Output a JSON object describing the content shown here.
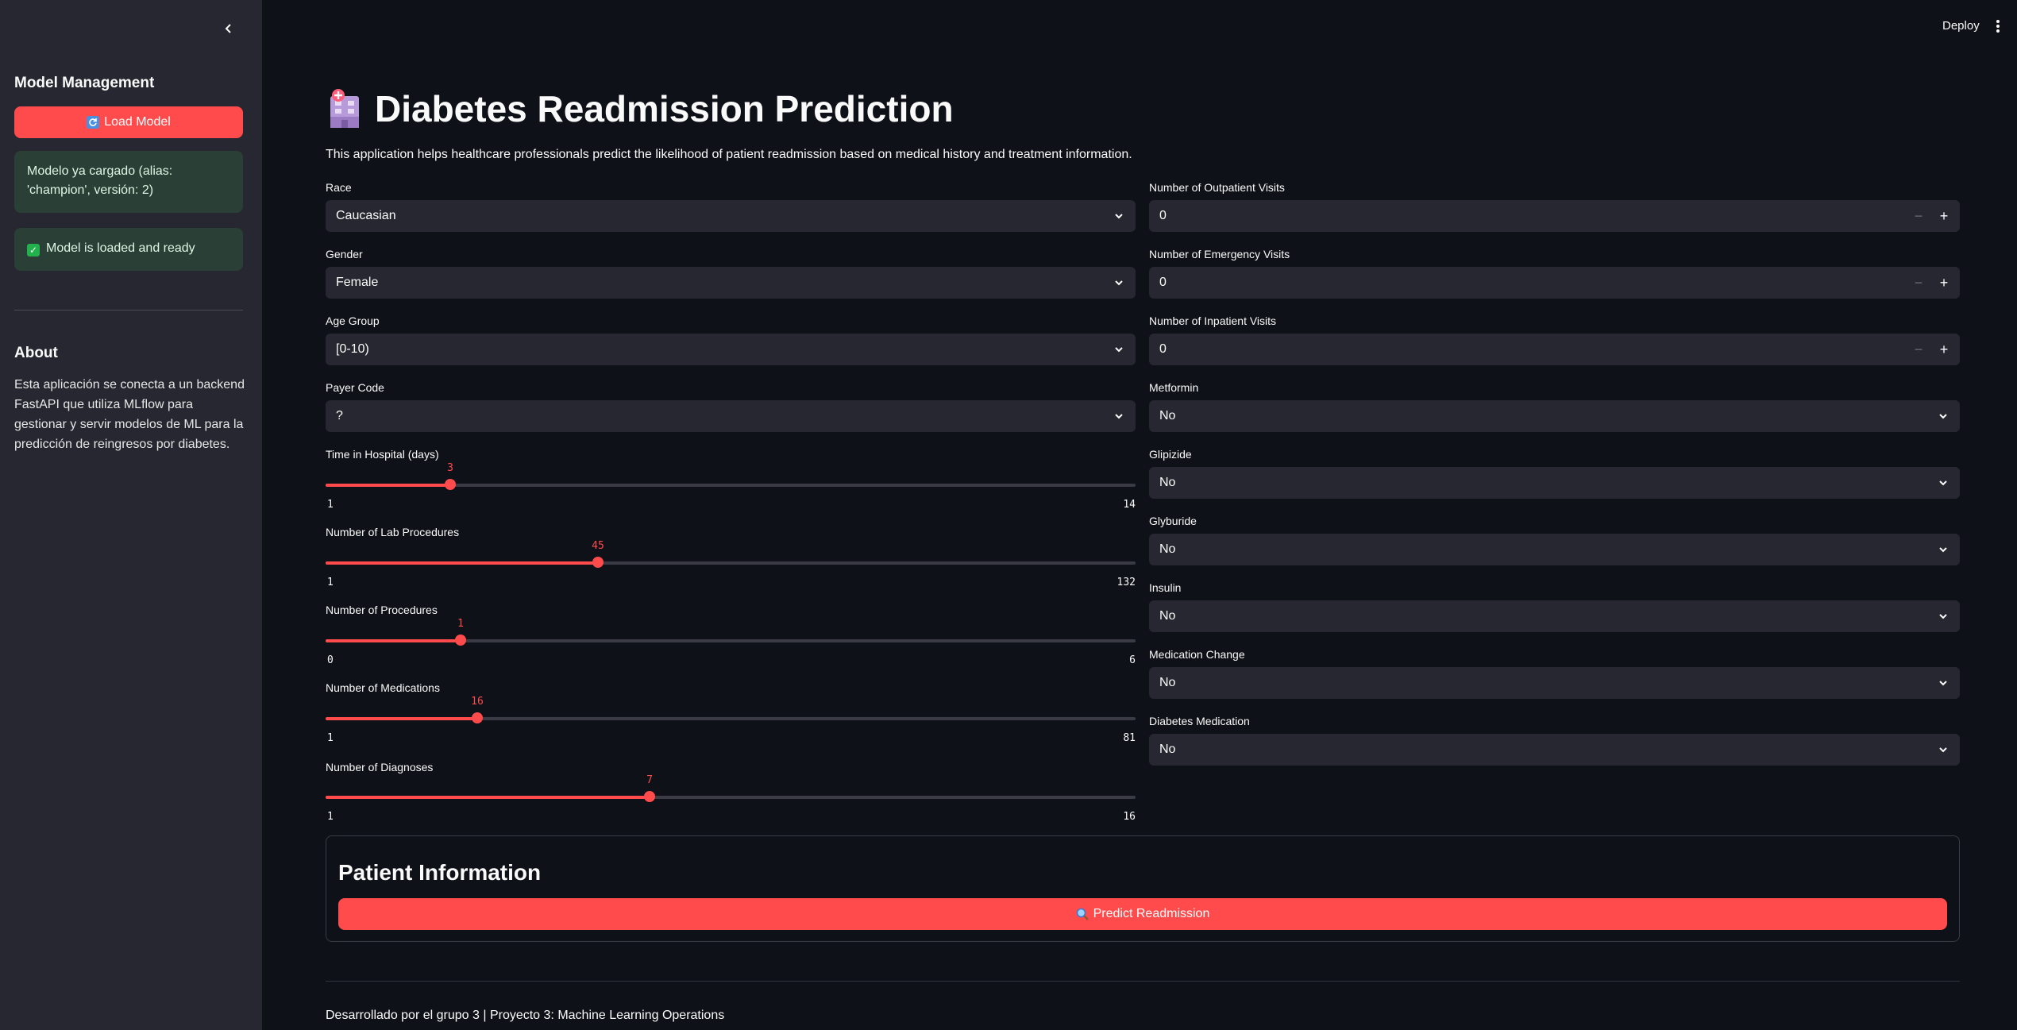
{
  "sidebar": {
    "heading": "Model Management",
    "load_button": "Load Model",
    "load_icon": "refresh-icon",
    "alert_info": "Modelo ya cargado (alias: 'champion', versión: 2)",
    "alert_success": "Model is loaded and ready",
    "about_heading": "About",
    "about_text": "Esta aplicación se conecta a un backend FastAPI que utiliza MLflow para gestionar y servir modelos de ML para la predicción de reingresos por diabetes."
  },
  "header": {
    "deploy": "Deploy"
  },
  "main": {
    "title": "Diabetes Readmission Prediction",
    "subtitle": "This application helps healthcare professionals predict the likelihood of patient readmission based on medical history and treatment information.",
    "left_selects": [
      {
        "label": "Race",
        "value": "Caucasian"
      },
      {
        "label": "Gender",
        "value": "Female"
      },
      {
        "label": "Age Group",
        "value": "[0-10)"
      },
      {
        "label": "Payer Code",
        "value": "?"
      }
    ],
    "sliders": [
      {
        "label": "Time in Hospital (days)",
        "value": 3,
        "min": 1,
        "max": 14
      },
      {
        "label": "Number of Lab Procedures",
        "value": 45,
        "min": 1,
        "max": 132
      },
      {
        "label": "Number of Procedures",
        "value": 1,
        "min": 0,
        "max": 6
      },
      {
        "label": "Number of Medications",
        "value": 16,
        "min": 1,
        "max": 81
      },
      {
        "label": "Number of Diagnoses",
        "value": 7,
        "min": 1,
        "max": 16
      }
    ],
    "number_inputs": [
      {
        "label": "Number of Outpatient Visits",
        "value": "0"
      },
      {
        "label": "Number of Emergency Visits",
        "value": "0"
      },
      {
        "label": "Number of Inpatient Visits",
        "value": "0"
      }
    ],
    "right_selects": [
      {
        "label": "Metformin",
        "value": "No"
      },
      {
        "label": "Glipizide",
        "value": "No"
      },
      {
        "label": "Glyburide",
        "value": "No"
      },
      {
        "label": "Insulin",
        "value": "No"
      },
      {
        "label": "Medication Change",
        "value": "No"
      },
      {
        "label": "Diabetes Medication",
        "value": "No"
      }
    ],
    "form_title": "Patient Information",
    "predict_button": "Predict Readmission",
    "predict_icon": "magnifier-icon",
    "footer": "Desarrollado por el grupo 3 | Proyecto 3: Machine Learning Operations"
  },
  "colors": {
    "accent": "#ff4b4b",
    "background": "#0e1117",
    "sidebar": "#262730",
    "success": "#2a3f35"
  }
}
